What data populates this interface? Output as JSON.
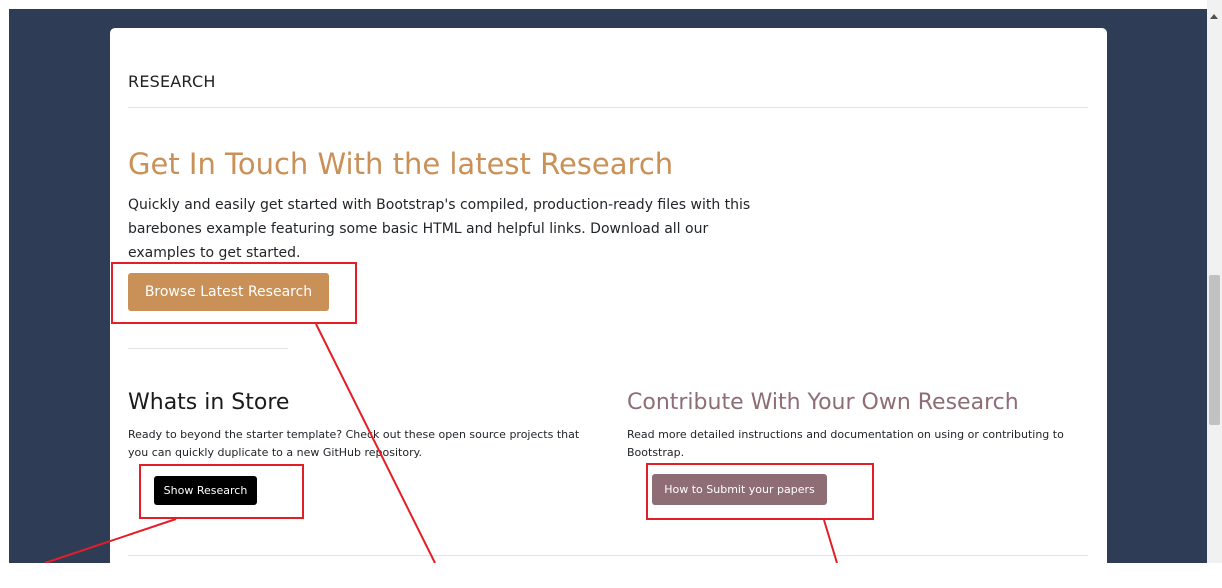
{
  "header": {
    "title": "RESEARCH"
  },
  "hero": {
    "title": "Get In Touch With the latest Research",
    "text": "Quickly and easily get started with Bootstrap's compiled, production-ready files with this barebones example featuring some basic HTML and helpful links. Download all our examples to get started.",
    "button_label": "Browse Latest Research"
  },
  "columns": [
    {
      "title": "Whats in Store",
      "text": "Ready to beyond the starter template? Check out these open source projects that you can quickly duplicate to a new GitHub repository.",
      "button_label": "Show Research"
    },
    {
      "title": "Contribute With Your Own Research",
      "text": "Read more detailed instructions and documentation on using or contributing to Bootstrap.",
      "button_label": "How to Submit your papers"
    }
  ],
  "colors": {
    "page_background": "#2e3d55",
    "accent_tan": "#c99158",
    "accent_mauve": "#8e6d74",
    "annotation_red": "#e41e26"
  }
}
